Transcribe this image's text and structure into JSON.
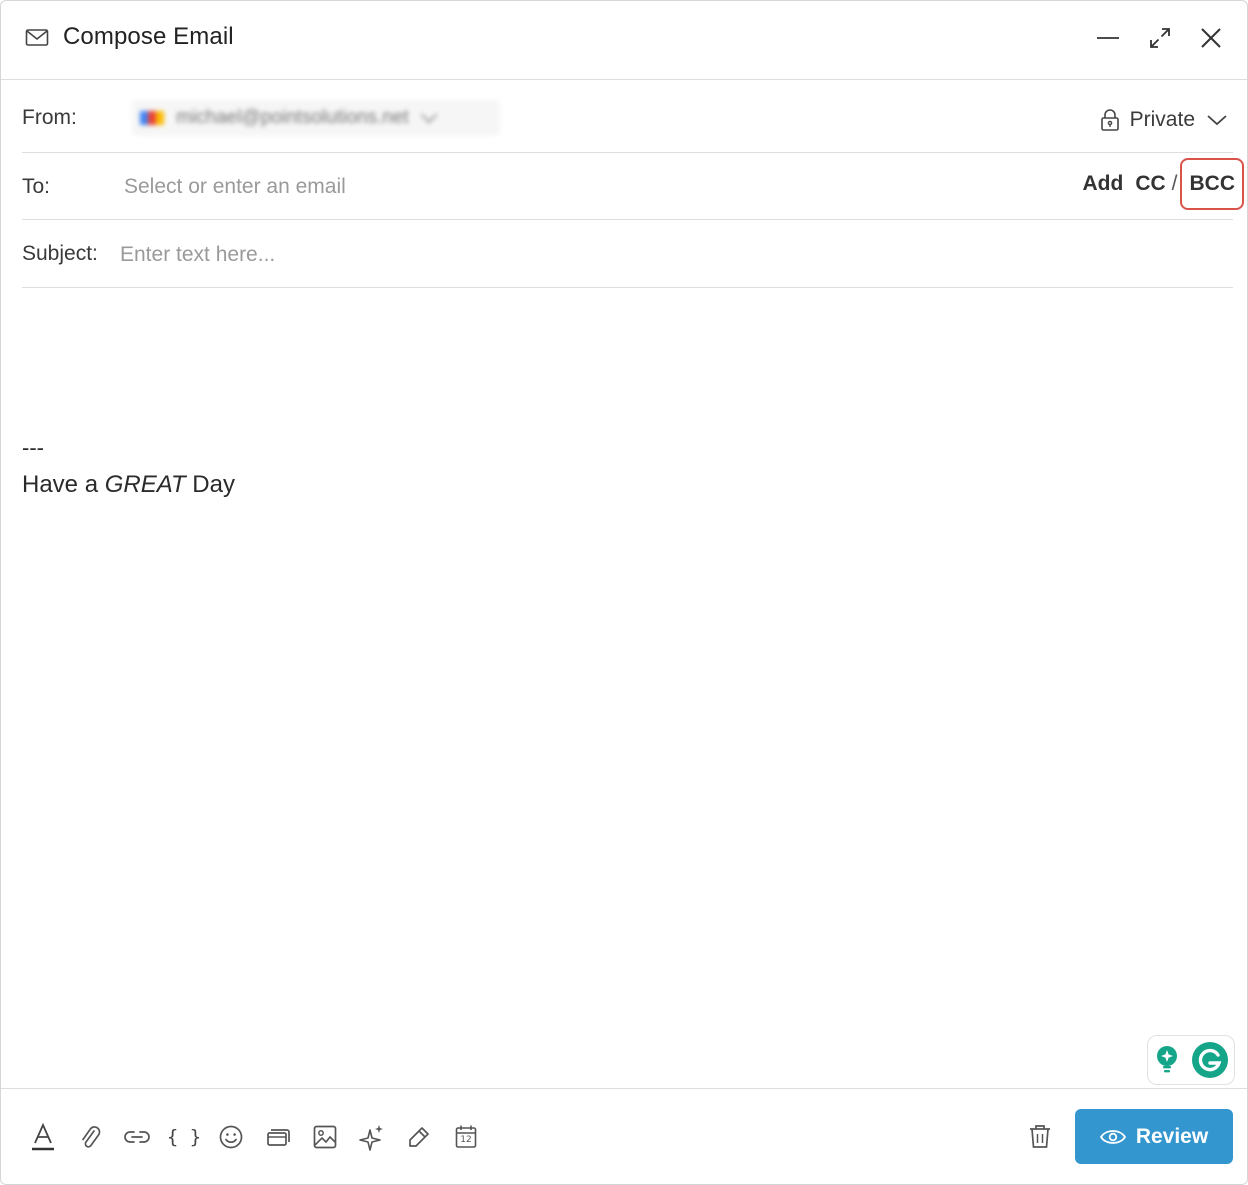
{
  "window": {
    "title": "Compose Email",
    "controls": [
      "minimize-icon",
      "expand-icon",
      "close-icon"
    ]
  },
  "from": {
    "label": "From:",
    "sender_value": "michael@pointsolutions.net",
    "privacy": {
      "label": "Private",
      "icon": "lock-icon"
    }
  },
  "to": {
    "label": "To:",
    "placeholder": "Select or enter an email",
    "add_label": "Add",
    "cc_label": "CC",
    "slash": "/",
    "bcc_label": "BCC",
    "highlight_color": "#d9534a"
  },
  "subject": {
    "label": "Subject:",
    "placeholder": "Enter text here..."
  },
  "body": {
    "signature_separator": "---",
    "signature_pre": "Have a ",
    "signature_emphasis": "GREAT",
    "signature_post": " Day"
  },
  "toolbar": {
    "tools": [
      "text-format-icon",
      "attachment-icon",
      "link-icon",
      "variables-icon",
      "emoji-icon",
      "template-icon",
      "image-icon",
      "ai-sparkle-icon",
      "signature-pen-icon",
      "calendar-icon"
    ],
    "calendar_day": "12",
    "variables_glyph": "{ }",
    "delete_icon": "trash-icon",
    "review_label": "Review",
    "review_color": "#3396cf"
  },
  "grammarly": {
    "brand_color": "#15a589",
    "logo_letter": "G"
  }
}
